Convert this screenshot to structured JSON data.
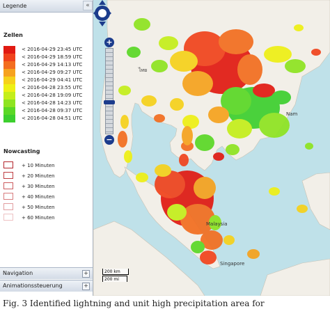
{
  "sidebar": {
    "collapse_glyph": "«",
    "legend_title": "Legende",
    "legend_tool": "—",
    "cells_title": "Zellen",
    "cells": [
      {
        "label": "< 2016-04-29 23:45 UTC",
        "color": "#e11a12"
      },
      {
        "label": "< 2016-04-29 18:59 UTC",
        "color": "#f0431c"
      },
      {
        "label": "< 2016-04-29 14:13 UTC",
        "color": "#f36d1f"
      },
      {
        "label": "< 2016-04-29 09:27 UTC",
        "color": "#f6a21e"
      },
      {
        "label": "< 2016-04-29 04:41 UTC",
        "color": "#f6d11a"
      },
      {
        "label": "< 2016-04-28 23:55 UTC",
        "color": "#eef014"
      },
      {
        "label": "< 2016-04-28 19:09 UTC",
        "color": "#c4ee1a"
      },
      {
        "label": "< 2016-04-28 14:23 UTC",
        "color": "#8ee420"
      },
      {
        "label": "< 2016-04-28 09:37 UTC",
        "color": "#5ad825"
      },
      {
        "label": "< 2016-04-28 04:51 UTC",
        "color": "#3ccf2e"
      }
    ],
    "nowcasting_title": "Nowcasting",
    "nowcasting": [
      {
        "label": "+ 10 Minuten",
        "color": "#b3242b"
      },
      {
        "label": "+ 20 Minuten",
        "color": "#bf3d42"
      },
      {
        "label": "+ 30 Minuten",
        "color": "#cb5a5e"
      },
      {
        "label": "+ 40 Minuten",
        "color": "#d77c7e"
      },
      {
        "label": "+ 50 Minuten",
        "color": "#e29ea0"
      },
      {
        "label": "+ 60 Minuten",
        "color": "#eec2c3"
      }
    ],
    "navigation_label": "Navigation",
    "animation_label": "Animationssteuerung",
    "plus_glyph": "+"
  },
  "map": {
    "zoom_in": "+",
    "zoom_out": "−",
    "scale_km": "200 km",
    "scale_mi": "200 mi",
    "labels": {
      "nam": "Nam",
      "malaysia": "Malaysia",
      "singapore": "Singapore",
      "thai": "ไทย"
    },
    "colors": {
      "water": "#bfe1e9",
      "land": "#f2efe8"
    }
  },
  "caption": "Fig. 3   Identified lightning and unit high precipitation area for"
}
